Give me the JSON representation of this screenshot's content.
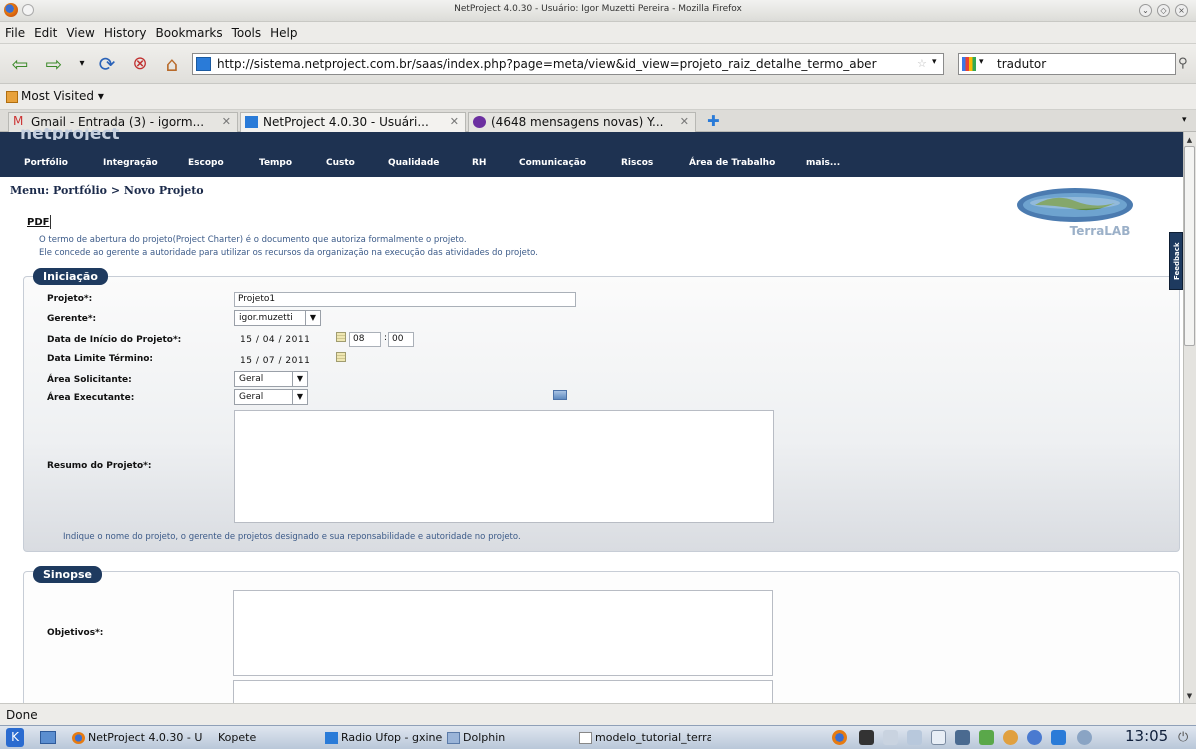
{
  "window": {
    "title": "NetProject 4.0.30 - Usuário: Igor Muzetti Pereira - Mozilla Firefox"
  },
  "menu": [
    "File",
    "Edit",
    "View",
    "History",
    "Bookmarks",
    "Tools",
    "Help"
  ],
  "toolbar": {
    "url": "http://sistema.netproject.com.br/saas/index.php?page=meta/view&id_view=projeto_raiz_detalhe_termo_aber",
    "search_value": "tradutor"
  },
  "bookmarks": {
    "most_visited": "Most Visited ▾"
  },
  "tabs": [
    {
      "label": "Gmail - Entrada (3) - igorm...",
      "active": false
    },
    {
      "label": "NetProject 4.0.30 - Usuári...",
      "active": true
    },
    {
      "label": "(4648 mensagens novas) Y...",
      "active": false
    }
  ],
  "app": {
    "logo": "netproject",
    "nav": [
      "Portfólio",
      "Integração",
      "Escopo",
      "Tempo",
      "Custo",
      "Qualidade",
      "RH",
      "Comunicação",
      "Riscos",
      "Área de Trabalho",
      "mais..."
    ],
    "breadcrumb": "Menu: Portfólio > Novo Projeto",
    "brand_logo_text": "TerraLAB",
    "pdf_label": "PDF",
    "description_1": "O termo de abertura do projeto(Project Charter) é o documento que autoriza formalmente o projeto.",
    "description_2": "Ele concede ao gerente a autoridade para utilizar os recursos da organização na execução das atividades do projeto.",
    "feedback": "Feedback"
  },
  "iniciacao": {
    "legend": "Iniciação",
    "projeto_label": "Projeto*:",
    "projeto_value": "Projeto1",
    "gerente_label": "Gerente*:",
    "gerente_value": "igor.muzetti",
    "data_inicio_label": "Data de Início do Projeto*:",
    "data_inicio_value": "15 / 04 / 2011",
    "hora": "08",
    "minuto": "00",
    "data_limite_label": "Data Limite Término:",
    "data_limite_value": "15 / 07 / 2011",
    "area_solicitante_label": "Área Solicitante:",
    "area_solicitante_value": "Geral",
    "area_executante_label": "Área Executante:",
    "area_executante_value": "Geral",
    "resumo_label": "Resumo do Projeto*:",
    "hint": "Indique o nome do projeto, o gerente de projetos designado e sua reponsabilidade e autoridade no projeto."
  },
  "sinopse": {
    "legend": "Sinopse",
    "objetivos_label": "Objetivos*:"
  },
  "status": {
    "text": "Done"
  },
  "taskbar": {
    "items": [
      "NetProject 4.0.30 - U",
      "Kopete",
      "Radio Ufop - gxine",
      "Dolphin",
      "modelo_tutorial_terra"
    ],
    "clock": "13:05"
  }
}
